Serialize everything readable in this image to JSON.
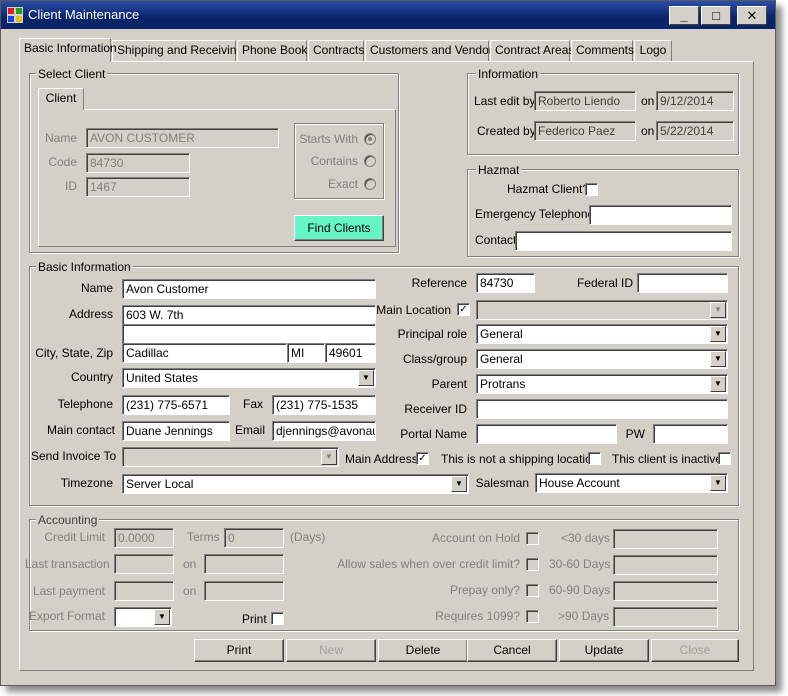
{
  "window": {
    "title": "Client Maintenance"
  },
  "caption_buttons": {
    "minimize": "_",
    "maximize": "□",
    "close": "✕"
  },
  "tabs": [
    "Basic Information",
    "Shipping and Receiving",
    "Phone Book",
    "Contracts",
    "Customers and Vendors",
    "Contract Areas",
    "Comments",
    "Logo"
  ],
  "select_client": {
    "group_title": "Select Client",
    "inner_tab": "Client",
    "name_label": "Name",
    "name_value": "AVON CUSTOMER",
    "code_label": "Code",
    "code_value": "84730",
    "id_label": "ID",
    "id_value": "1467",
    "starts_with": "Starts With",
    "contains": "Contains",
    "exact": "Exact",
    "find_button": "Find Clients"
  },
  "information": {
    "group_title": "Information",
    "last_edit_label": "Last edit by",
    "last_edit_by": "Roberto Liendo",
    "on_label": "on",
    "last_edit_date": "9/12/2014",
    "created_label": "Created by",
    "created_by": "Federico  Paez",
    "created_date": "5/22/2014"
  },
  "hazmat": {
    "group_title": "Hazmat",
    "client_label": "Hazmat Client?",
    "emergency_label": "Emergency Telephone",
    "contact_label": "Contact"
  },
  "basic": {
    "group_title": "Basic Information",
    "name_label": "Name",
    "name": "Avon Customer",
    "address_label": "Address",
    "address1": "603 W. 7th",
    "address2": "",
    "csz_label": "City, State, Zip",
    "city": "Cadillac",
    "state": "MI",
    "zip": "49601",
    "country_label": "Country",
    "country": "United States",
    "telephone_label": "Telephone",
    "telephone": "(231) 775-6571",
    "fax_label": "Fax",
    "fax": "(231) 775-1535",
    "contact_label": "Main contact",
    "contact": "Duane Jennings",
    "email_label": "Email",
    "email": "djennings@avonaut",
    "send_invoice_label": "Send Invoice To",
    "main_address_label": "Main Address",
    "not_shipping_label": "This is not a shipping location",
    "inactive_label": "This client is inactive",
    "timezone_label": "Timezone",
    "timezone": "Server Local",
    "reference_label": "Reference",
    "reference": "84730",
    "federal_label": "Federal ID",
    "main_location_label": "Main Location",
    "role_label": "Principal role",
    "role": "General",
    "class_label": "Class/group",
    "class": "General",
    "parent_label": "Parent",
    "parent": "Protrans",
    "receiver_label": "Receiver ID",
    "portal_label": "Portal Name",
    "pw_label": "PW",
    "salesman_label": "Salesman",
    "salesman": "House Account"
  },
  "accounting": {
    "group_title": "Accounting",
    "credit_label": "Credit Limit",
    "credit": "0.0000",
    "terms_label": "Terms",
    "terms": "0",
    "days_label": "(Days)",
    "last_tx_label": "Last transaction",
    "on_label": "on",
    "last_pay_label": "Last payment",
    "export_label": "Export Format",
    "print_label": "Print",
    "hold_label": "Account on Hold",
    "allow_label": "Allow sales when over credit limit?",
    "prepay_label": "Prepay only?",
    "req1099_label": "Requires 1099?",
    "d30": "<30 days",
    "d3060": "30-60 Days",
    "d6090": "60-90 Days",
    "d90": ">90 Days"
  },
  "buttons": {
    "print": "Print",
    "new": "New",
    "delete": "Delete",
    "cancel": "Cancel",
    "update": "Update",
    "close": "Close"
  },
  "checks": {
    "checked": "✓"
  },
  "icons": {
    "dropdown": "▼"
  }
}
